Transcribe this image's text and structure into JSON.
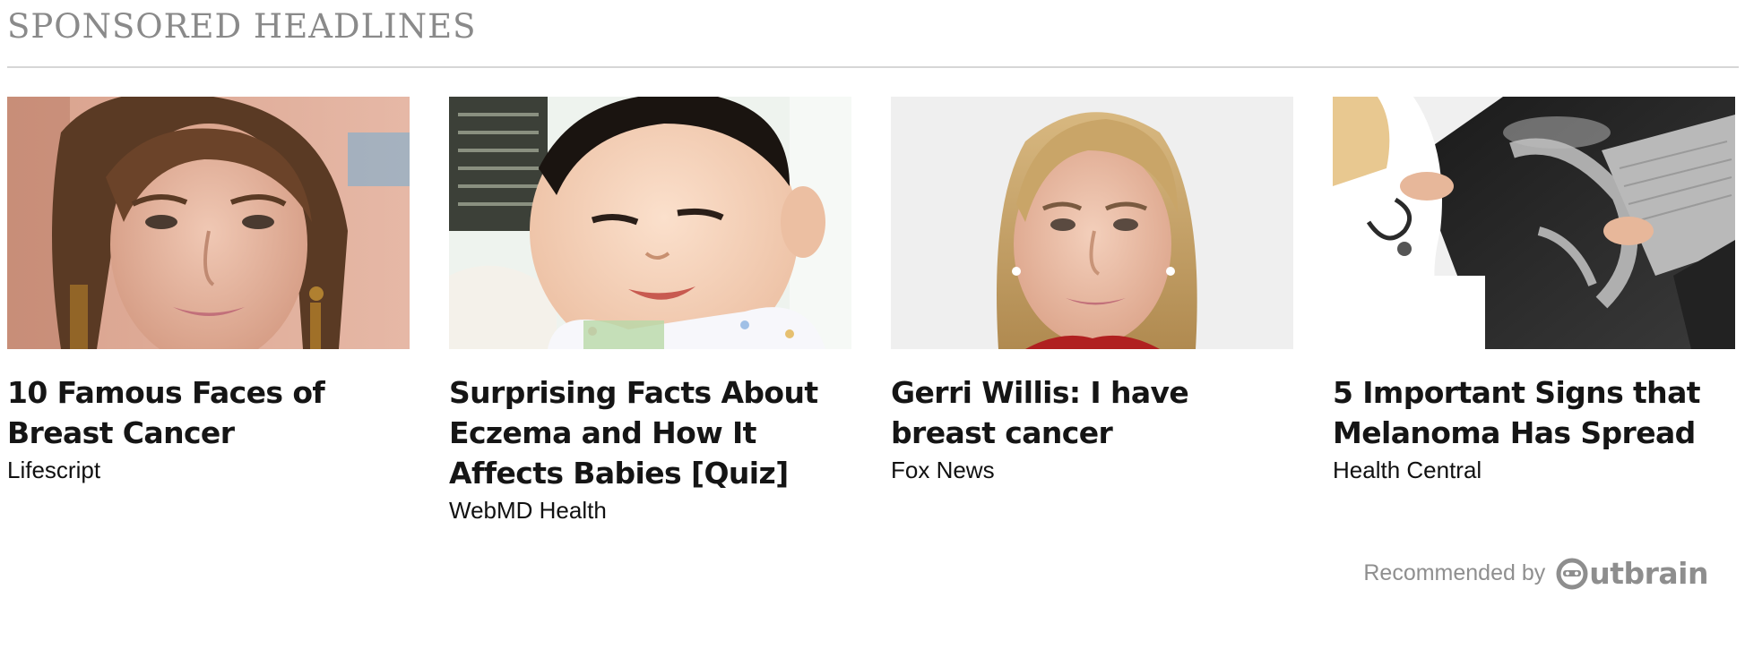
{
  "widget": {
    "title": "SPONSORED HEADLINES",
    "cards": [
      {
        "title": "10 Famous Faces of Breast Cancer",
        "source": "Lifescript",
        "image": "woman-portrait-photo"
      },
      {
        "title": "Surprising Facts About Eczema and How It Affects Babies [Quiz]",
        "source": "WebMD Health",
        "image": "baby-photo"
      },
      {
        "title": "Gerri Willis: I have breast cancer",
        "source": "Fox News",
        "image": "blonde-woman-portrait-photo"
      },
      {
        "title": "5 Important Signs that Melanoma Has Spread",
        "source": "Health Central",
        "image": "doctor-xray-photo"
      }
    ],
    "attribution": {
      "text": "Recommended by",
      "brand_rest": "utbrain"
    }
  },
  "colors": {
    "title": "#8a8a8a",
    "divider": "#d6d6d6",
    "headline": "#151515",
    "source": "#111111",
    "attribution": "#8f8f8f"
  }
}
